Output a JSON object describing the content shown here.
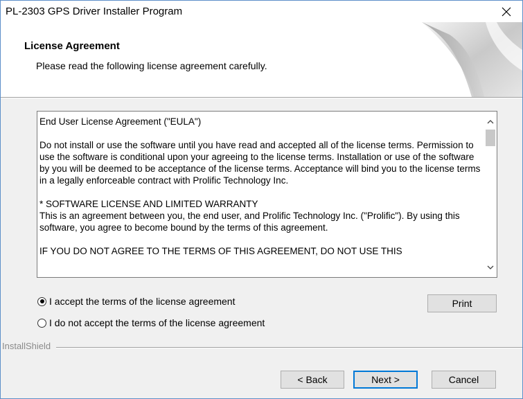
{
  "window": {
    "title": "PL-2303 GPS Driver Installer Program"
  },
  "header": {
    "title": "License Agreement",
    "subtitle": "Please read the following license agreement carefully."
  },
  "license": {
    "paragraphs": [
      "End User License Agreement (\"EULA\")",
      "Do not install or use the software until you have read and accepted all of the license terms. Permission to use the software is conditional upon your agreeing to the license terms. Installation or use of the software by you will be deemed to be acceptance of the license terms. Acceptance will bind you to the license terms in a legally enforceable contract with Prolific Technology Inc.",
      "* SOFTWARE LICENSE AND LIMITED WARRANTY",
      "This is an agreement between you, the end user, and Prolific Technology Inc. (\"Prolific\"). By using this software, you agree to become bound by the terms of this agreement.",
      "IF YOU DO NOT AGREE TO THE TERMS OF THIS AGREEMENT, DO NOT USE THIS"
    ]
  },
  "options": {
    "accept_label": "I accept the terms of the license agreement",
    "decline_label": "I do not accept the terms of the license agreement",
    "selected": "accept"
  },
  "buttons": {
    "print": "Print",
    "back": "< Back",
    "next": "Next >",
    "cancel": "Cancel"
  },
  "footer": {
    "brand": "InstallShield"
  }
}
